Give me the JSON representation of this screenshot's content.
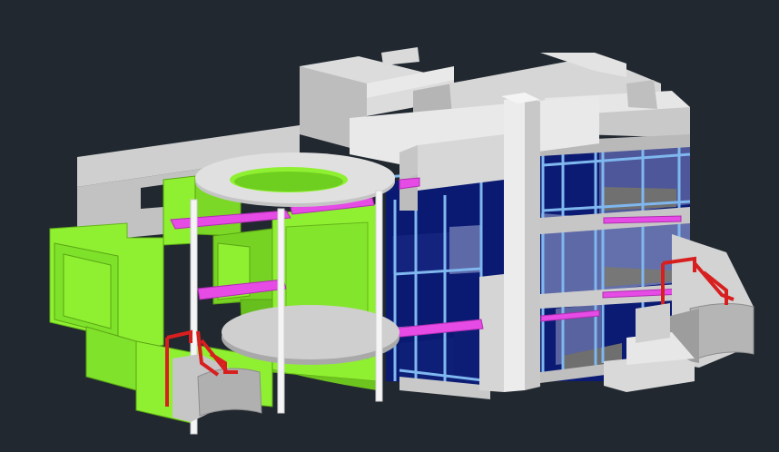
{
  "viewport": {
    "background": "#212830",
    "subject": "3d-house-model"
  },
  "colors": {
    "grey_light": "#e6e6e6",
    "grey_mid": "#cfcfcf",
    "grey_dark": "#a9a9a9",
    "green_light": "#8ff031",
    "green_mid": "#73d21c",
    "green_dark": "#5aa514",
    "blue_frame": "#7fb7ee",
    "navy_glass": "#0a1a72",
    "slate_glass": "#5e6aa8",
    "magenta_beam": "#e64be6",
    "red_rail": "#d81f1f",
    "white_column": "#f5f5f5"
  }
}
